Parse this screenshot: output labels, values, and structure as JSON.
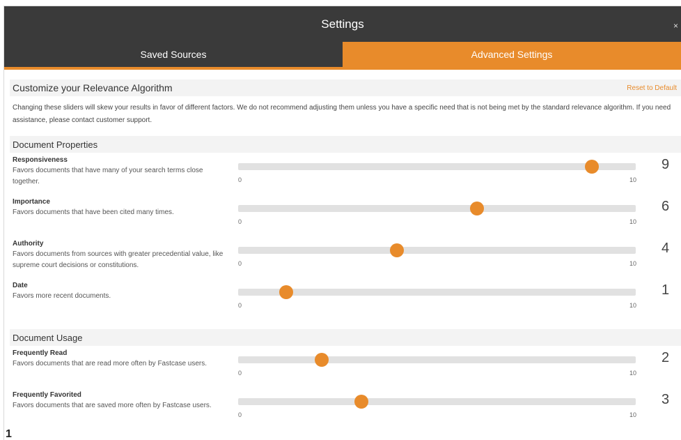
{
  "window": {
    "title": "Settings",
    "close_label": "×"
  },
  "tabs": [
    {
      "label": "Saved Sources",
      "active": false
    },
    {
      "label": "Advanced Settings",
      "active": true
    }
  ],
  "customize": {
    "heading": "Customize your Relevance Algorithm",
    "reset_label": "Reset to Default",
    "description": "Changing these sliders will skew your results in favor of different factors. We do not recommend adjusting them unless you have a specific need that is not being met by the standard relevance algorithm. If you need assistance, please contact customer support."
  },
  "sections": [
    {
      "heading": "Document Properties",
      "sliders": [
        {
          "name": "Responsiveness",
          "description": "Favors documents that have many of your search terms close together.",
          "value": 9,
          "value_label": "9",
          "min": 0,
          "max": 10,
          "min_label": "0",
          "max_label": "10",
          "position": 0.89
        },
        {
          "name": "Importance",
          "description": "Favors documents that have been cited many times.",
          "value": 6,
          "value_label": "6",
          "min": 0,
          "max": 10,
          "min_label": "0",
          "max_label": "10",
          "position": 0.6
        },
        {
          "name": "Authority",
          "description": "Favors documents from sources with greater precedential value, like supreme court decisions or constitutions.",
          "value": 4,
          "value_label": "4",
          "min": 0,
          "max": 10,
          "min_label": "0",
          "max_label": "10",
          "position": 0.4
        },
        {
          "name": "Date",
          "description": "Favors more recent documents.",
          "value": 1,
          "value_label": "1",
          "min": 0,
          "max": 10,
          "min_label": "0",
          "max_label": "10",
          "position": 0.12
        }
      ]
    },
    {
      "heading": "Document Usage",
      "sliders": [
        {
          "name": "Frequently Read",
          "description": "Favors documents that are read more often by Fastcase users.",
          "value": 2,
          "value_label": "2",
          "min": 0,
          "max": 10,
          "min_label": "0",
          "max_label": "10",
          "position": 0.21
        },
        {
          "name": "Frequently Favorited",
          "description": "Favors documents that are saved more often by Fastcase users.",
          "value": 3,
          "value_label": "3",
          "min": 0,
          "max": 10,
          "min_label": "0",
          "max_label": "10",
          "position": 0.31
        }
      ]
    }
  ],
  "corner_label": "1",
  "colors": {
    "accent": "#e88b2b",
    "titlebar": "#3a3a3a",
    "track": "#e1e1e1"
  }
}
